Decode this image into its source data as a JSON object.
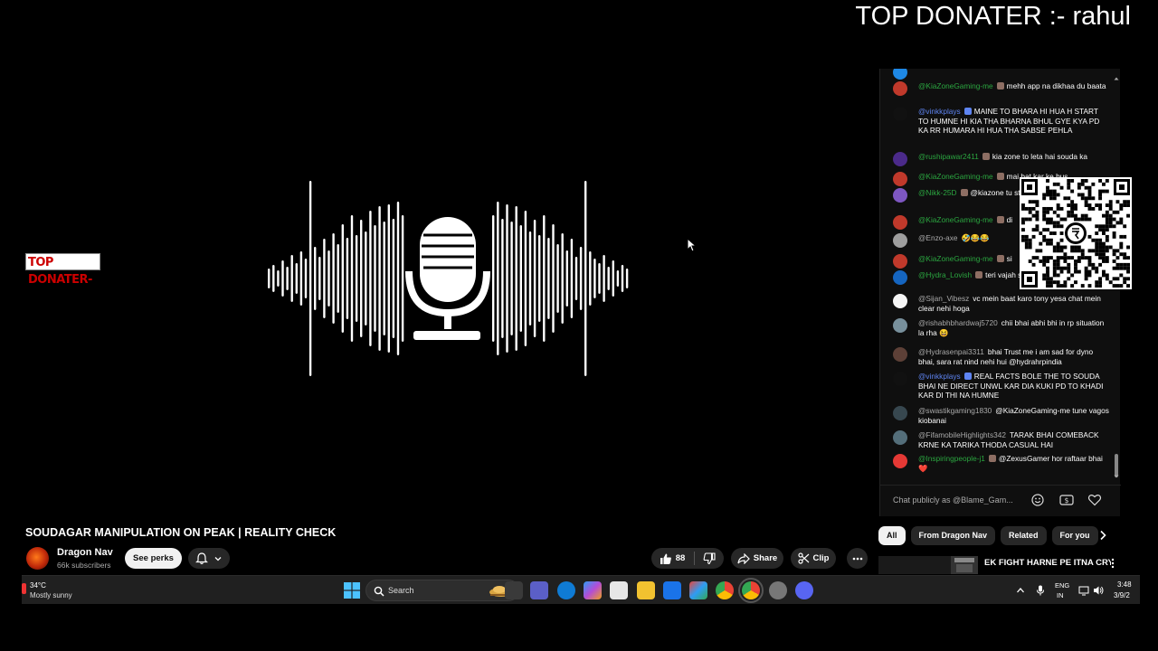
{
  "overlay": {
    "top_donater_banner": "TOP DONATER :- rahul",
    "top_donater_tag": "TOP DONATER-"
  },
  "video": {
    "title": "SOUDAGAR MANIPULATION ON PEAK | REALITY CHECK",
    "channel_name": "Dragon Nav",
    "subscribers": "66k subscribers",
    "see_perks_label": "See perks",
    "like_count": "88",
    "share_label": "Share",
    "clip_label": "Clip"
  },
  "chat": {
    "input_placeholder": "Chat publicly as @Blame_Gam...",
    "messages": [
      {
        "author": "@KiaZoneGaming-me",
        "text": "mehh app na dikhaa du baata",
        "author_style": "member",
        "avatar_color": "#c0392b"
      },
      {
        "author": "@vinkkplays",
        "text": "MAINE TO BHARA HI HUA H START TO HUMNE HI KIA THA BHARNA BHUL GYE KYA PD KA RR HUMARA HI HUA THA SABSE PEHLA",
        "author_style": "mod",
        "avatar_color": "#111111"
      },
      {
        "author": "@rushipawar2411",
        "text": "kia zone to leta hai souda ka",
        "author_style": "member",
        "avatar_color": "#4b2a8a"
      },
      {
        "author": "@KiaZoneGaming-me",
        "text": "mai bat kar ke bus",
        "author_style": "member",
        "avatar_color": "#c0392b"
      },
      {
        "author": "@Nikk-25D",
        "text": "@kiazone tu store kiya ki nhi to",
        "author_style": "member",
        "avatar_color": "#7e57c2"
      },
      {
        "author": "@KiaZoneGaming-me",
        "text": "di",
        "author_style": "member",
        "avatar_color": "#c0392b"
      },
      {
        "author": "@Enzo-axe",
        "text": "🤣😂😂",
        "author_style": "normal",
        "avatar_color": "#9e9e9e"
      },
      {
        "author": "@KiaZoneGaming-me",
        "text": "si",
        "author_style": "member",
        "avatar_color": "#c0392b"
      },
      {
        "author": "@Hydra_Lovish",
        "text": "teri vajah se khrab ho gayi",
        "author_style": "member",
        "avatar_color": "#1565c0"
      },
      {
        "author": "@Sijan_Vibesz",
        "text": "vc mein baat karo tony yesa chat mein clear nehi hoga",
        "author_style": "normal",
        "avatar_color": "#f5f5f5"
      },
      {
        "author": "@rishabhbhardwaj5720",
        "text": "chii bhai abhi bhi in rp situation la rha 😆",
        "author_style": "normal",
        "avatar_color": "#78909c"
      },
      {
        "author": "@Hydrasenpai3311",
        "text": "bhai Trust me i am sad for dyno bhai, sara rat nind nehi hui @hydrahrpindia",
        "author_style": "normal",
        "avatar_color": "#5d4037"
      },
      {
        "author": "@vinkkplays",
        "text": "REAL FACTS BOLE THE TO SOUDA BHAI NE DIRECT UNWL KAR DIA KUKI PD TO KHADI KAR DI THI NA HUMNE",
        "author_style": "mod",
        "avatar_color": "#111111"
      },
      {
        "author": "@swastikgaming1830",
        "text": "@KiaZoneGaming-me tune vagos kiobanai",
        "author_style": "normal",
        "avatar_color": "#37474f"
      },
      {
        "author": "@FifamobileHighlights342",
        "text": "TARAK BHAI COMEBACK KRNE KA TARIKA THODA CASUAL HAI",
        "author_style": "normal",
        "avatar_color": "#546e7a"
      },
      {
        "author": "@Inspiringpeople-j1",
        "text": "@ZexusGamer hor raftaar bhai ❤️",
        "author_style": "member",
        "avatar_color": "#e53935"
      }
    ]
  },
  "recommendations": {
    "tabs": [
      "All",
      "From Dragon Nav",
      "Related",
      "For you"
    ],
    "first_title": "EK FIGHT HARNE PE ITNA CRY?"
  },
  "taskbar": {
    "weather_temp": "34°C",
    "weather_condition": "Mostly sunny",
    "search_label": "Search",
    "language_top": "ENG",
    "language_bottom": "IN",
    "time": "3:48",
    "date": "3/9/2"
  },
  "colors": {
    "page_bg": "#000000",
    "chat_bg": "#0f0f0f",
    "member_green": "#2ba640",
    "chip_bg": "#272727"
  }
}
